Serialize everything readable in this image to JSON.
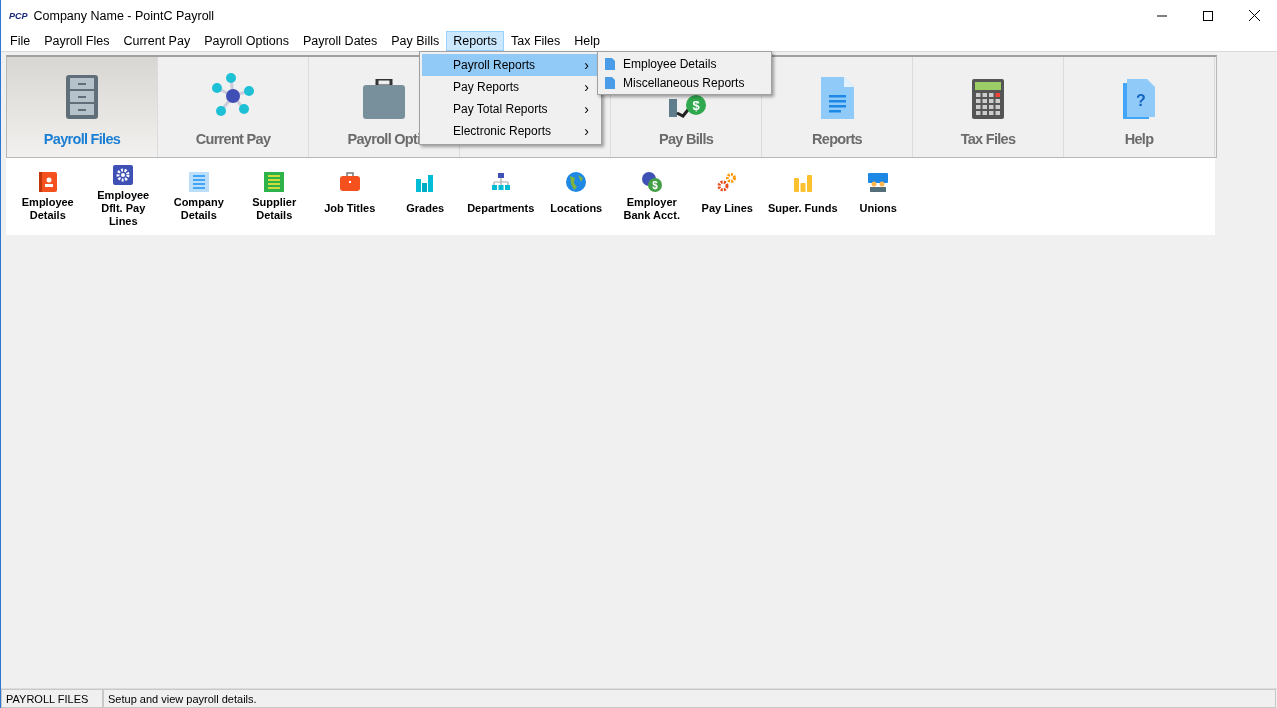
{
  "window": {
    "logo": "PCP",
    "title": "Company Name - PointC Payroll"
  },
  "menu_bar": [
    {
      "label": "File",
      "selected": false
    },
    {
      "label": "Payroll Fles",
      "selected": false
    },
    {
      "label": "Current Pay",
      "selected": false
    },
    {
      "label": "Payroll Options",
      "selected": false
    },
    {
      "label": "Payroll Dates",
      "selected": false
    },
    {
      "label": "Pay Bills",
      "selected": false
    },
    {
      "label": "Reports",
      "selected": true
    },
    {
      "label": "Tax Files",
      "selected": false
    },
    {
      "label": "Help",
      "selected": false
    }
  ],
  "ribbon_tabs": [
    {
      "label": "Payroll Files",
      "kind": "cabinet",
      "selected": true
    },
    {
      "label": "Current Pay",
      "kind": "network",
      "selected": false
    },
    {
      "label": "Payroll Opti",
      "kind": "briefcase",
      "selected": false
    },
    {
      "kind": "hidden",
      "selected": false
    },
    {
      "label": "Pay Bills",
      "kind": "bills",
      "icon_text": "$",
      "selected": false
    },
    {
      "label": "Reports",
      "kind": "document",
      "selected": false
    },
    {
      "label": "Tax Files",
      "kind": "calculator",
      "selected": false
    },
    {
      "label": "Help",
      "kind": "help",
      "icon_text": "?",
      "selected": false
    }
  ],
  "toolbar": [
    {
      "label": "Employee Details",
      "kind": "contact"
    },
    {
      "label": "Employee Dflt. Pay Lines",
      "kind": "gear"
    },
    {
      "label": "Company Details",
      "kind": "list"
    },
    {
      "label": "Supplier Details",
      "kind": "greenlist"
    },
    {
      "label": "Job Titles",
      "kind": "case"
    },
    {
      "label": "Grades",
      "kind": "bars"
    },
    {
      "label": "Departments",
      "kind": "org"
    },
    {
      "label": "Locations",
      "kind": "globe"
    },
    {
      "label": "Employer Bank Acct.",
      "kind": "coins",
      "icon_text": "$"
    },
    {
      "label": "Pay Lines",
      "kind": "gears"
    },
    {
      "label": "Super. Funds",
      "kind": "stacks"
    },
    {
      "label": "Unions",
      "kind": "people"
    }
  ],
  "reports_menu": [
    {
      "label": "Payroll Reports",
      "selected": true
    },
    {
      "label": "Pay Reports",
      "selected": false
    },
    {
      "label": "Pay Total Reports",
      "selected": false
    },
    {
      "label": "Electronic Reports",
      "selected": false
    }
  ],
  "submenu_arrow": "›",
  "payroll_reports_submenu": [
    "Employee Details",
    "Miscellaneous Reports"
  ],
  "status_bar": {
    "section": "PAYROLL FILES",
    "message": "Setup and view payroll details."
  }
}
